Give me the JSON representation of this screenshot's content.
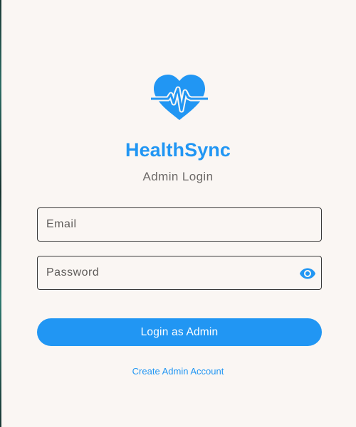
{
  "brand": {
    "name": "HealthSync",
    "logo_icon": "heartbeat-icon",
    "accent_color": "#2196f3"
  },
  "login": {
    "subtitle": "Admin Login",
    "email_placeholder": "Email",
    "password_placeholder": "Password",
    "password_toggle_icon": "eye-icon",
    "submit_label": "Login as Admin",
    "create_account_label": "Create Admin Account"
  }
}
